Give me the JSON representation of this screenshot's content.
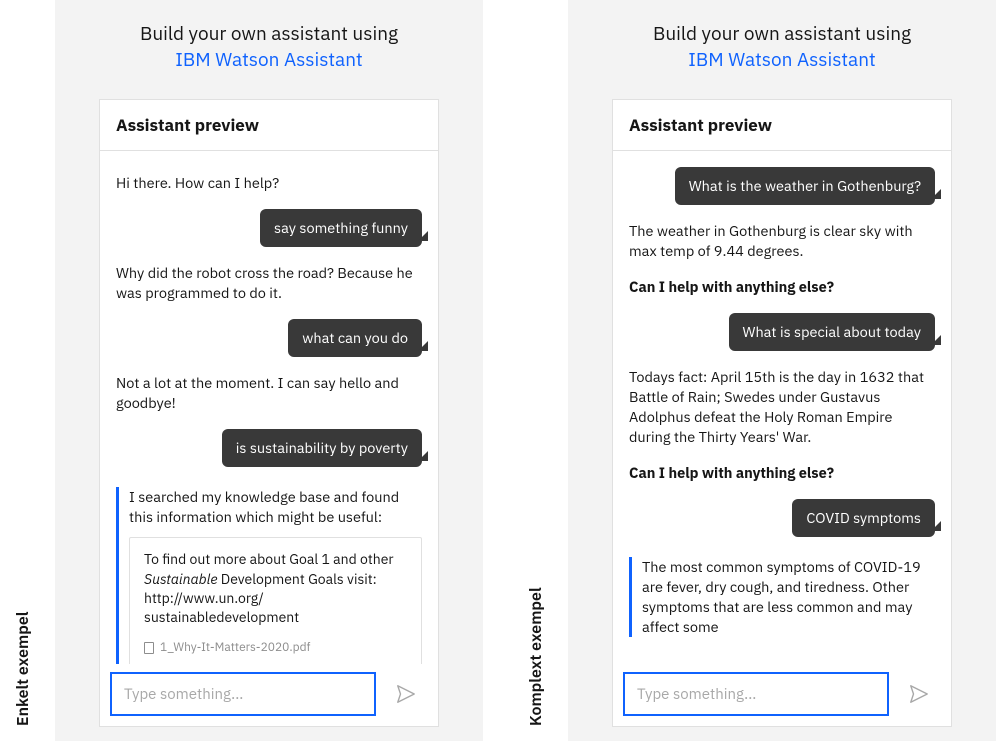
{
  "left": {
    "side_label": "Enkelt exempel",
    "heading_line1": "Build your own assistant using",
    "heading_link": "IBM Watson Assistant",
    "chat_title": "Assistant preview",
    "m1_bot": "Hi there. How can I help?",
    "m2_user": "say something funny",
    "m3_bot": "Why did the robot cross the road? Because he was programmed to do it.",
    "m4_user": "what can you do",
    "m5_bot": "Not a lot at the moment. I can say hello and goodbye!",
    "m6_user": "is sustainability by poverty",
    "search_intro": "I searched my knowledge base and found this information which might be useful:",
    "search_body_a": "To find out more about Goal 1 and other ",
    "search_body_ital": "Sustainable",
    "search_body_b": " Development Goals visit: http://www.un.org/ sustainabledevelopment",
    "search_file": "1_Why-It-Matters-2020.pdf",
    "input_placeholder": "Type something..."
  },
  "right": {
    "side_label": "Komplext exempel",
    "heading_line1": "Build your own assistant using",
    "heading_link": "IBM Watson Assistant",
    "chat_title": "Assistant preview",
    "m1_user": "What is the weather in Gothenburg?",
    "m2_bot": "The weather in Gothenburg is clear sky with max temp of 9.44 degrees.",
    "m3_prompt": "Can I help with anything else?",
    "m4_user": "What is special about today",
    "m5_bot": "Todays fact: April 15th is the day in 1632 that Battle of Rain; Swedes under Gustavus Adolphus defeat the Holy Roman Empire during the Thirty Years' War.",
    "m6_prompt": "Can I help with anything else?",
    "m7_user": "COVID symptoms",
    "m8_search": "The most common symptoms of COVID-19 are fever, dry cough, and tiredness. Other symptoms that are less common and may affect some",
    "input_placeholder": "Type something..."
  }
}
